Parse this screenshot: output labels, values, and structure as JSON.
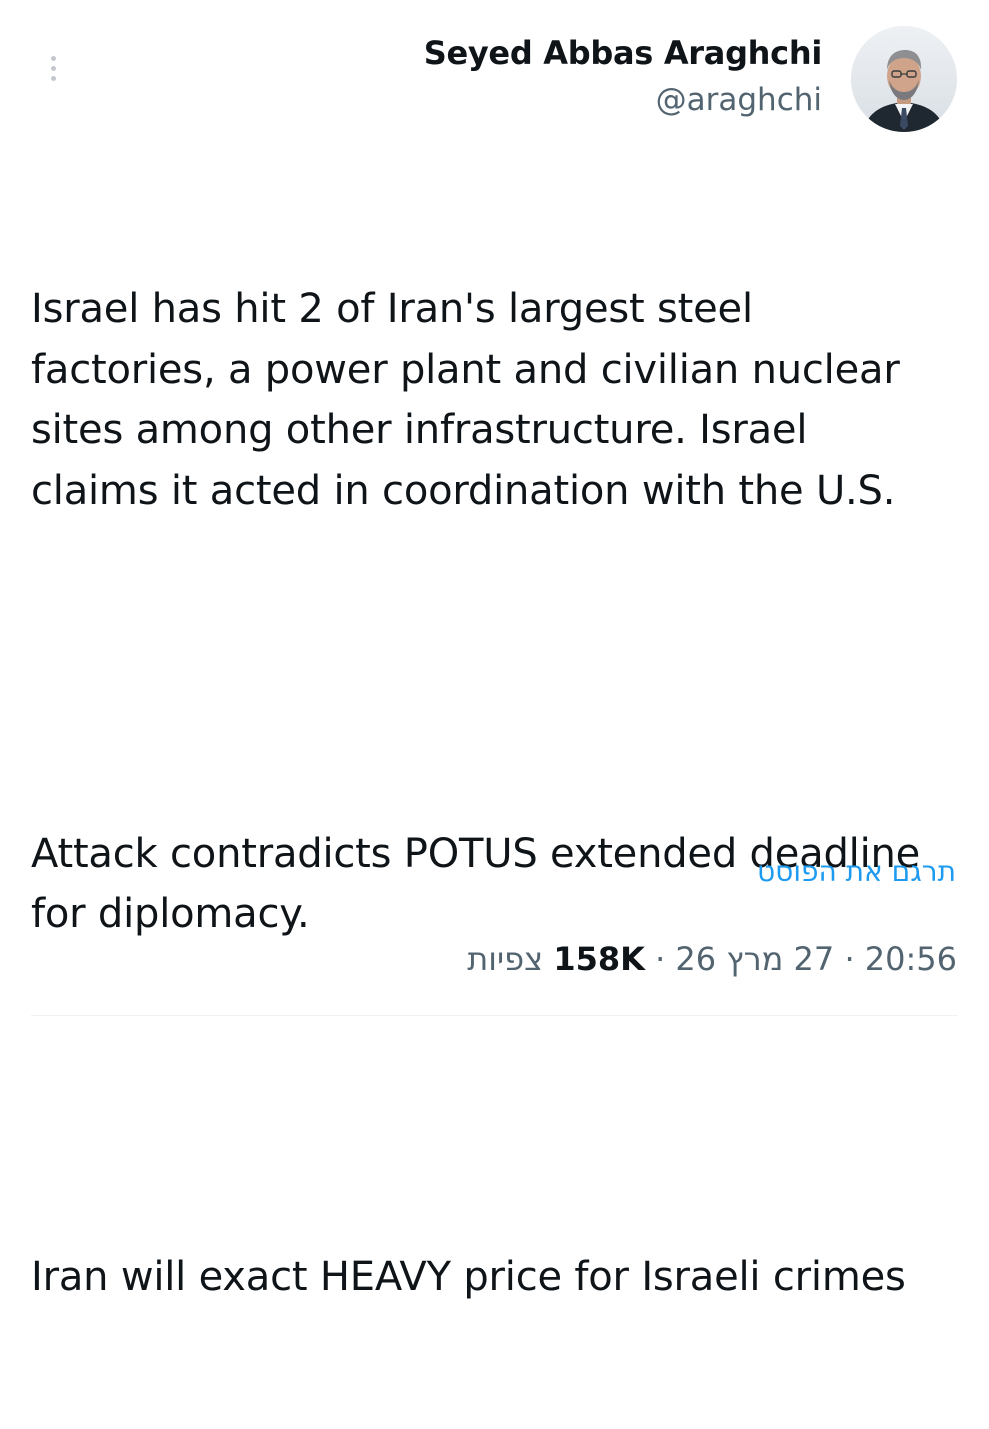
{
  "author": {
    "display_name": "Seyed Abbas Araghchi",
    "handle": "@araghchi"
  },
  "post": {
    "paragraph_1": "Israel has hit 2 of Iran's largest steel factories, a power plant and civilian nuclear sites among other infrastructure. Israel claims it acted in coordination with the U.S.",
    "paragraph_2": "Attack contradicts POTUS extended deadline for diplomacy.",
    "paragraph_3": "Iran will exact HEAVY price for Israeli crimes",
    "translate_label": "תרגם את הפוסט"
  },
  "meta": {
    "time": "20:56",
    "date": "27 מרץ 26",
    "separator": "·",
    "views_count": "158K",
    "views_label": "צפיות"
  },
  "colors": {
    "text": "#0f1419",
    "secondary": "#536471",
    "link": "#1d9bf0",
    "divider": "#eff3f4"
  },
  "icons": {
    "more": "vertical-dots-icon",
    "avatar": "user-avatar"
  }
}
